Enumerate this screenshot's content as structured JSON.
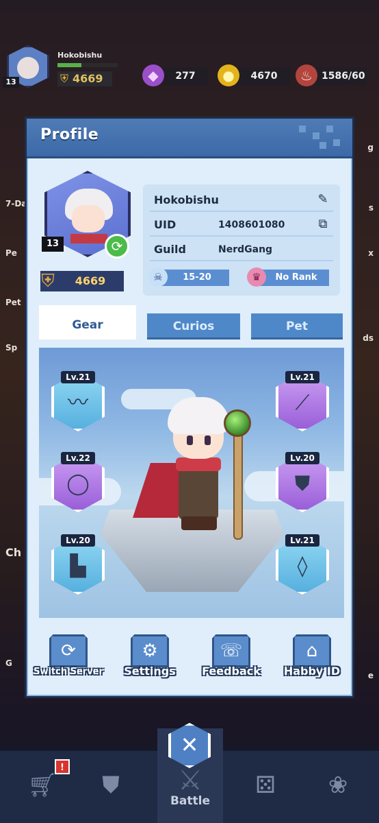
{
  "topbar": {
    "player_name": "Hokobishu",
    "player_level": "13",
    "power": "4669",
    "xp_progress": 0.4,
    "gems": "277",
    "coins": "4670",
    "stamina": "1586/60"
  },
  "side": {
    "left_labels": [
      "7-Da",
      "Pe",
      "Pet",
      "Sp",
      "Ch",
      "G"
    ],
    "right_labels": [
      "g",
      "s",
      "x",
      "ds",
      "e"
    ]
  },
  "profile": {
    "title": "Profile",
    "level": "13",
    "power": "4669",
    "name_key_value": "Hokobishu",
    "uid_label": "UID",
    "uid_value": "1408601080",
    "guild_label": "Guild",
    "guild_value": "NerdGang",
    "rank_range": "15-20",
    "rank_tier": "No Rank"
  },
  "tabs": [
    {
      "label": "Gear",
      "active": true
    },
    {
      "label": "Curios",
      "active": false
    },
    {
      "label": "Pet",
      "active": false
    }
  ],
  "gear_slots": [
    {
      "level": "Lv.21",
      "item_icon": "scarf-icon",
      "rarity": "blue"
    },
    {
      "level": "Lv.22",
      "item_icon": "ring-icon",
      "rarity": "purple"
    },
    {
      "level": "Lv.20",
      "item_icon": "boots-icon",
      "rarity": "blue"
    },
    {
      "level": "Lv.21",
      "item_icon": "staff-icon",
      "rarity": "purple"
    },
    {
      "level": "Lv.20",
      "item_icon": "armor-icon",
      "rarity": "purple"
    },
    {
      "level": "Lv.21",
      "item_icon": "necklace-icon",
      "rarity": "blue"
    }
  ],
  "actions": [
    {
      "label": "Switch Server",
      "icon": "refresh-icon"
    },
    {
      "label": "Settings",
      "icon": "gear-icon"
    },
    {
      "label": "Feedback",
      "icon": "chat-icon"
    },
    {
      "label": "Habby ID",
      "icon": "id-icon"
    }
  ],
  "nav": {
    "battle_label": "Battle",
    "shop_notification": "!"
  }
}
